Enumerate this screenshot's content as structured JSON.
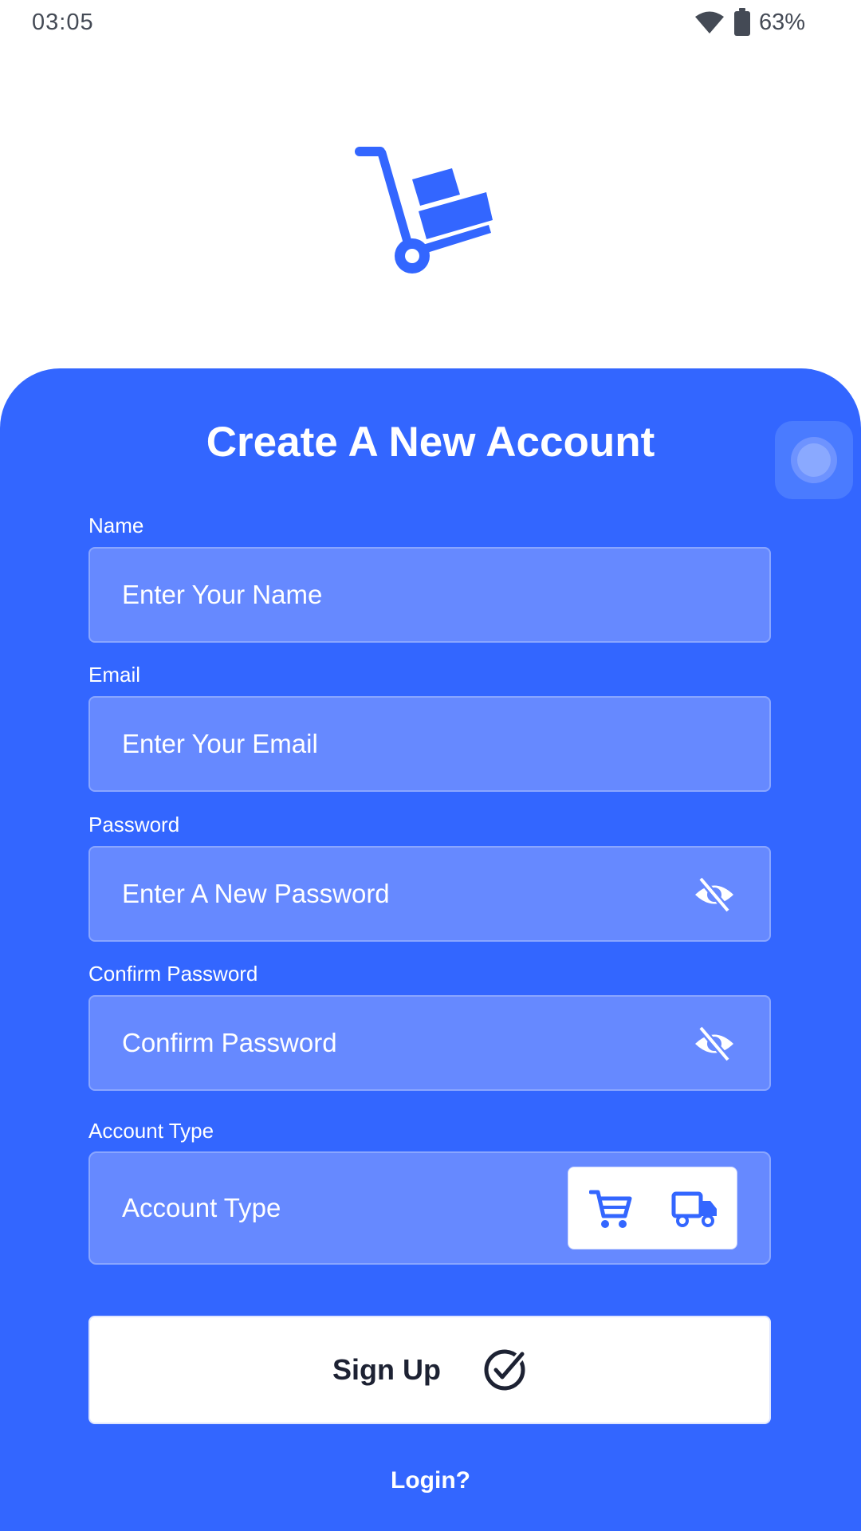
{
  "status_bar": {
    "time": "03:05",
    "battery": "63%",
    "icons": [
      "wifi-icon",
      "battery-icon"
    ]
  },
  "logo": {
    "icon": "hand-truck-icon"
  },
  "title": "Create A New Account",
  "form": {
    "name": {
      "label": "Name",
      "placeholder": "Enter Your Name",
      "value": ""
    },
    "email": {
      "label": "Email",
      "placeholder": "Enter Your Email",
      "value": ""
    },
    "password": {
      "label": "Password",
      "placeholder": "Enter A New Password",
      "value": "",
      "toggle_icon": "eye-off-icon"
    },
    "confirm_password": {
      "label": "Confirm Password",
      "placeholder": "Confirm Password",
      "value": "",
      "toggle_icon": "eye-off-icon"
    },
    "account_type": {
      "label": "Account Type",
      "value": "Account Type",
      "options": [
        {
          "icon": "cart-icon"
        },
        {
          "icon": "truck-icon"
        }
      ]
    }
  },
  "signup_button": {
    "label": "Sign Up",
    "icon": "check-circle-icon"
  },
  "login_link": "Login?",
  "colors": {
    "primary": "#3366ff",
    "field_bg": "#6689ff",
    "text_dark": "#1d2233",
    "white": "#ffffff"
  }
}
